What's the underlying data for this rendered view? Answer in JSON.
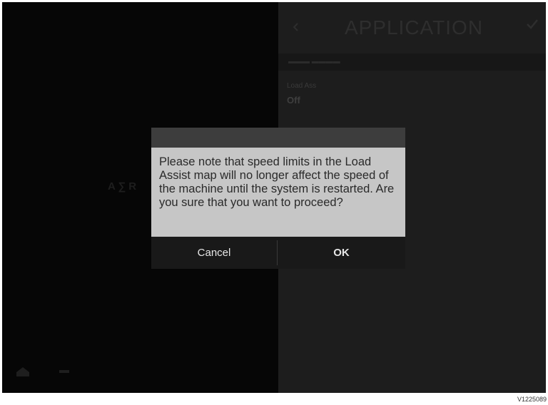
{
  "colors": {
    "screen_bg": "#020202",
    "right_panel_bg": "#1d1d1d",
    "dialog_body_bg": "#c6c6c6",
    "dialog_titlebar_bg": "#3d3d3d",
    "dialog_buttons_bg": "#191919",
    "button_text": "#e6e6e6"
  },
  "header": {
    "title": "APPLICATION",
    "back_icon": "back-arrow-icon",
    "confirm_icon": "check-icon"
  },
  "settings": {
    "label": "Load Ass",
    "value": "Off"
  },
  "dialog": {
    "message": "Please note that speed limits in the Load Assist map will no longer affect the speed of the machine until the system is restarted. Are you sure that you want to proceed?",
    "cancel_label": "Cancel",
    "ok_label": "OK"
  },
  "image_code": "V1225089"
}
